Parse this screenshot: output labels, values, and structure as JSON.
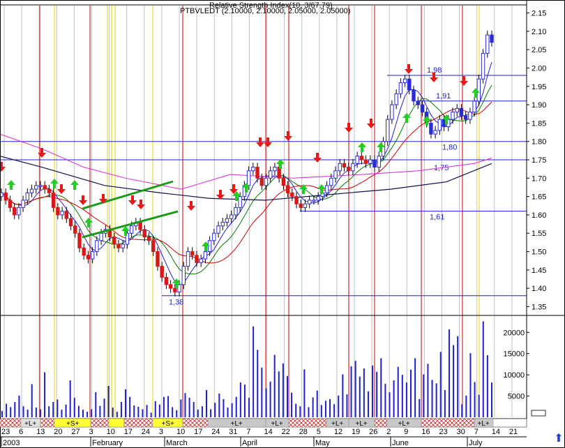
{
  "chart_data": {
    "type": "candlestick",
    "title_lines": [
      "Relative Strength Index(10, 3/67.79)",
      "PTBVLEDT (2.10000, 2.10000, 2.05000, 2.05000)"
    ],
    "x_ticks": [
      "23",
      "6",
      "13",
      "20",
      "27",
      "3",
      "10",
      "17",
      "24",
      "3",
      "10",
      "17",
      "24",
      "31",
      "7",
      "14",
      "22",
      "28",
      "5",
      "12",
      "19",
      "26",
      "2",
      "9",
      "16",
      "23",
      "30",
      "7",
      "14",
      "21"
    ],
    "month_labels": [
      "2003",
      "February",
      "March",
      "April",
      "May",
      "June",
      "July"
    ],
    "price_axis": {
      "min": 1.33,
      "max": 2.17,
      "ticks": [
        "2.15",
        "2.10",
        "2.05",
        "2.00",
        "1.95",
        "1.90",
        "1.85",
        "1.80",
        "1.75",
        "1.70",
        "1.65",
        "1.60",
        "1.55",
        "1.50",
        "1.45",
        "1.40",
        "1.35"
      ]
    },
    "volume_axis": {
      "min": 0,
      "max": 23500,
      "ticks": [
        "20000",
        "15000",
        "10000",
        "5000"
      ]
    },
    "horizontal_levels": [
      {
        "label": "1,98",
        "value": 1.98
      },
      {
        "label": "1,91",
        "value": 1.91
      },
      {
        "label": "1,80",
        "value": 1.8
      },
      {
        "label": "1,75",
        "value": 1.75
      },
      {
        "label": "1,61",
        "value": 1.61
      },
      {
        "label": "1,38",
        "value": 1.38
      }
    ],
    "ohlc_close_series": [
      1.66,
      1.64,
      1.62,
      1.6,
      1.62,
      1.64,
      1.66,
      1.67,
      1.68,
      1.68,
      1.67,
      1.66,
      1.62,
      1.6,
      1.61,
      1.59,
      1.57,
      1.55,
      1.51,
      1.49,
      1.48,
      1.5,
      1.53,
      1.55,
      1.56,
      1.54,
      1.52,
      1.51,
      1.52,
      1.55,
      1.57,
      1.58,
      1.56,
      1.54,
      1.53,
      1.5,
      1.46,
      1.43,
      1.41,
      1.4,
      1.39,
      1.41,
      1.46,
      1.5,
      1.49,
      1.47,
      1.48,
      1.5,
      1.53,
      1.55,
      1.57,
      1.58,
      1.59,
      1.6,
      1.62,
      1.65,
      1.68,
      1.72,
      1.73,
      1.7,
      1.68,
      1.7,
      1.72,
      1.73,
      1.7,
      1.68,
      1.66,
      1.65,
      1.63,
      1.62,
      1.63,
      1.64,
      1.64,
      1.65,
      1.66,
      1.68,
      1.7,
      1.72,
      1.74,
      1.73,
      1.72,
      1.74,
      1.76,
      1.75,
      1.74,
      1.75,
      1.73,
      1.76,
      1.8,
      1.86,
      1.9,
      1.93,
      1.96,
      1.97,
      1.94,
      1.91,
      1.9,
      1.88,
      1.85,
      1.82,
      1.83,
      1.86,
      1.84,
      1.86,
      1.88,
      1.89,
      1.87,
      1.86,
      1.88,
      1.91,
      1.97,
      2.04,
      2.09,
      2.07
    ],
    "volume_bars": [
      1500,
      3200,
      2400,
      3600,
      5100,
      2600,
      1800,
      7800,
      2300,
      1900,
      10600,
      2600,
      3600,
      4200,
      1800,
      3000,
      8700,
      4600,
      2700,
      1800,
      1300,
      1900,
      5900,
      2700,
      4400,
      7400,
      2300,
      1300,
      3600,
      6600,
      4800,
      2800,
      2500,
      1900,
      2900,
      1100,
      3800,
      3000,
      4800,
      5000,
      2400,
      1700,
      4200,
      5700,
      4600,
      3600,
      1800,
      2600,
      6400,
      1900,
      3400,
      5600,
      4300,
      2300,
      3300,
      4800,
      8200,
      7700,
      4600,
      21400,
      15900,
      11700,
      6800,
      8400,
      14700,
      10800,
      12700,
      9700,
      5800,
      3200,
      2600,
      11300,
      2400,
      4700,
      6300,
      2900,
      3900,
      4300,
      3100,
      5100,
      10100,
      5400,
      12000,
      13300,
      9600,
      11500,
      6100,
      12200,
      10700,
      13900,
      7900,
      5900,
      8700,
      11900,
      10000,
      8200,
      11200,
      13900,
      4300,
      10100,
      12600,
      8800,
      8000,
      15400,
      6400,
      20700,
      17000,
      19100,
      3100,
      5100,
      15100,
      8300,
      5300,
      22600,
      14600,
      8200
    ],
    "volume_series_name": "",
    "ma_lines": [
      "magenta",
      "red",
      "green",
      "blue",
      "navy"
    ],
    "buy_signals": 20,
    "sell_signals": 17,
    "signal_bands": [
      {
        "label": "+L+",
        "color": "#e0e0e0"
      },
      {
        "label": "+S+",
        "color": "#ffff33"
      },
      {
        "label": "+S+",
        "color": "#ffff33"
      },
      {
        "label": "+L+",
        "color": "#c8c8c8"
      },
      {
        "label": "+L+",
        "color": "#c8c8c8"
      },
      {
        "label": "+L+",
        "color": "#c8c8c8"
      },
      {
        "label": "+L+",
        "color": "#c8c8c8"
      },
      {
        "label": "+L+",
        "color": "#c8c8c8"
      },
      {
        "label": "+L+",
        "color": "#c8c8c8"
      }
    ]
  },
  "ui": {
    "corner_arrow_icon": "up-arrow-icon"
  }
}
